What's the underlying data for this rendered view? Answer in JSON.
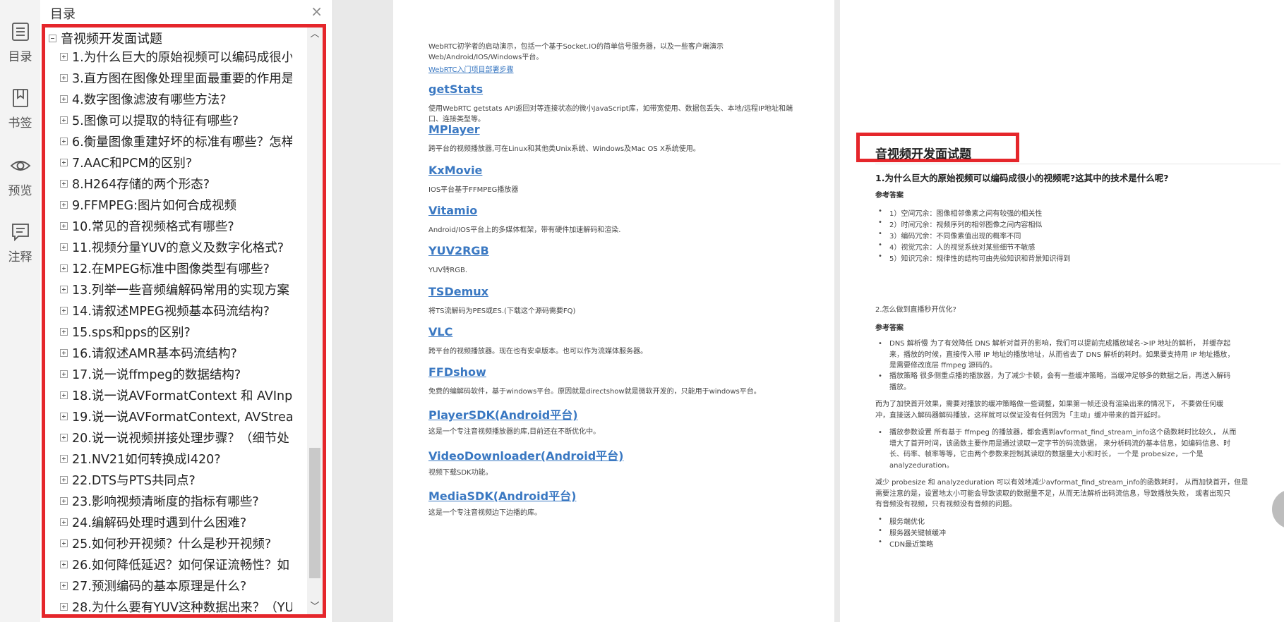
{
  "sidebar_rail": {
    "items": [
      {
        "label": "目录",
        "icon": "toc-list-icon"
      },
      {
        "label": "书签",
        "icon": "bookmark-icon"
      },
      {
        "label": "预览",
        "icon": "eye-icon"
      },
      {
        "label": "注释",
        "icon": "comment-icon"
      }
    ]
  },
  "toc": {
    "title": "目录",
    "close_glyph": "×",
    "root_label": "音视频开发面试题",
    "items": [
      "1.为什么巨大的原始视频可以编码成很小",
      "3.直方图在图像处理里面最重要的作用是",
      "4.数字图像滤波有哪些方法?",
      "5.图像可以提取的特征有哪些?",
      "6.衡量图像重建好坏的标准有哪些？怎样",
      "7.AAC和PCM的区别?",
      "8.H264存储的两个形态?",
      "9.FFMPEG:图片如何合成视频",
      "10.常见的音视频格式有哪些?",
      "11.视频分量YUV的意义及数字化格式?",
      "12.在MPEG标准中图像类型有哪些?",
      "13.列举一些音频编解码常用的实现方案",
      "14.请叙述MPEG视频基本码流结构?",
      "15.sps和pps的区别?",
      "16.请叙述AMR基本码流结构?",
      "17.说一说ffmpeg的数据结构?",
      "18.说一说AVFormatContext 和 AVInp",
      "19.说一说AVFormatContext, AVStrea",
      "20.说一说视频拼接处理步骤？（细节处",
      "21.NV21如何转换成I420?",
      "22.DTS与PTS共同点?",
      "23.影响视频清晰度的指标有哪些?",
      "24.编解码处理时遇到什么困难?",
      "25.如何秒开视频？什么是秒开视频?",
      "26.如何降低延迟？如何保证流畅性？如",
      "27.预测编码的基本原理是什么?",
      "28.为什么要有YUV这种数据出来？（YU"
    ],
    "scroll_up_glyph": "︿",
    "scroll_down_glyph": "﹀"
  },
  "page_left": {
    "intro_lines": [
      "WebRTC初学者的启动演示，包括一个基于Socket.IO的简单信号服务器，以及一些客户端演示",
      "Web/Android/IOS/Windows平台。"
    ],
    "intro_link": "WebRTC入门项目部署步骤",
    "libraries": [
      {
        "name": "getStats",
        "desc": [
          "使用WebRTC getstats API返回对等连接状态的微小JavaScript库，如带宽使用、数据包丢失、本地/远程IP地址和端",
          "口、连接类型等。"
        ]
      },
      {
        "name": "MPlayer",
        "desc": [
          "跨平台的视频播放器,可在Linux和其他类Unix系统、Windows及Mac OS X系统使用。"
        ]
      },
      {
        "name": "KxMovie",
        "desc": [
          "IOS平台基于FFMPEG播放器"
        ]
      },
      {
        "name": "Vitamio",
        "desc": [
          "Android/IOS平台上的多媒体框架，带有硬件加速解码和渲染."
        ]
      },
      {
        "name": "YUV2RGB",
        "desc": [
          "YUV转RGB."
        ]
      },
      {
        "name": "TSDemux",
        "desc": [
          "将TS流解码为PES或ES.(下载这个源码需要FQ)"
        ]
      },
      {
        "name": "VLC",
        "desc": [
          "跨平台的视频播放器。现在也有安卓版本。也可以作为流媒体服务器。"
        ]
      },
      {
        "name": "FFDshow",
        "desc": [
          "免费的编解码软件，基于windows平台。原因就是directshow就是微软开发的，只能用于windows平台。"
        ]
      },
      {
        "name": "PlayerSDK(Android平台)",
        "desc": [
          "这是一个专注音视频播放器的库,目前还在不断优化中。"
        ]
      },
      {
        "name": "VideoDownloader(Android平台)",
        "desc": [
          "视频下载SDK功能。"
        ]
      },
      {
        "name": "MediaSDK(Android平台)",
        "desc": [
          "这是一个专注音视频边下边播的库。"
        ]
      }
    ]
  },
  "page_right": {
    "heading": "音视频开发面试题",
    "q1": "1.为什么巨大的原始视频可以编码成很小的视频呢?这其中的技术是什么呢?",
    "answer_label": "参考答案",
    "q1_points": [
      "1）空间冗余：图像相邻像素之间有较强的相关性",
      "2）时间冗余：视频序列的相邻图像之间内容相似",
      "3）编码冗余：不同像素值出现的概率不同",
      "4）视觉冗余：人的视觉系统对某些细节不敏感",
      "5）知识冗余：规律性的结构可由先验知识和背景知识得到"
    ],
    "q2": "2.怎么做到直播秒开优化?",
    "q2_answer_label": "参考答案",
    "q2_bullet1": [
      "DNS 解析慢 为了有效降低 DNS 解析对首开的影响，我们可以提前完成播放域名->IP 地址的解析， 并缓存起",
      "来，播放的时候，直接传入带 IP 地址的播放地址，从而省去了 DNS 解析的耗时。如果要支持用 IP 地址播放，",
      "是需要修改底层 ffmpeg 源码的。"
    ],
    "q2_bullet2": [
      "播放策略 很多侧重点播的播放器，为了减少卡顿，会有一些缓冲策略，当缓冲足够多的数据之后，再送入解码",
      "播放。"
    ],
    "q2_para1": [
      "而为了加快首开效果，需要对播放的缓冲策略做一些调整，如果第一帧还没有渲染出来的情况下， 不要做任何缓",
      "冲，直接送入解码器解码播放，这样就可以保证没有任何因为「主动」缓冲带来的首开延时。"
    ],
    "q2_bullet3": [
      "播放参数设置 所有基于 ffmpeg 的播放器，都会遇到avformat_find_stream_info这个函数耗时比较久， 从而",
      "增大了首开时间，该函数主要作用是通过读取一定字节的码流数据， 来分析码流的基本信息，如编码信息、时",
      "长、码率、帧率等等，它由两个参数来控制其读取的数据量大小和时长， 一个是 probesize，一个是",
      "analyzeduration。"
    ],
    "q2_para2": [
      "减少 probesize 和 analyzeduration 可以有效地减少avformat_find_stream_info的函数耗时， 从而加快首开，但是",
      "需要注意的是，设置地太小可能会导致读取的数据量不足，从而无法解析出码流信息，导致播放失败， 或者出现只",
      "有音频没有视频，只有视频没有音频的问题。"
    ],
    "q2_list": [
      "服务端优化",
      "服务器关键帧缓冲",
      "CDN最近策略"
    ]
  },
  "colors": {
    "highlight_border": "#e5262b",
    "link": "#3a78c2"
  }
}
